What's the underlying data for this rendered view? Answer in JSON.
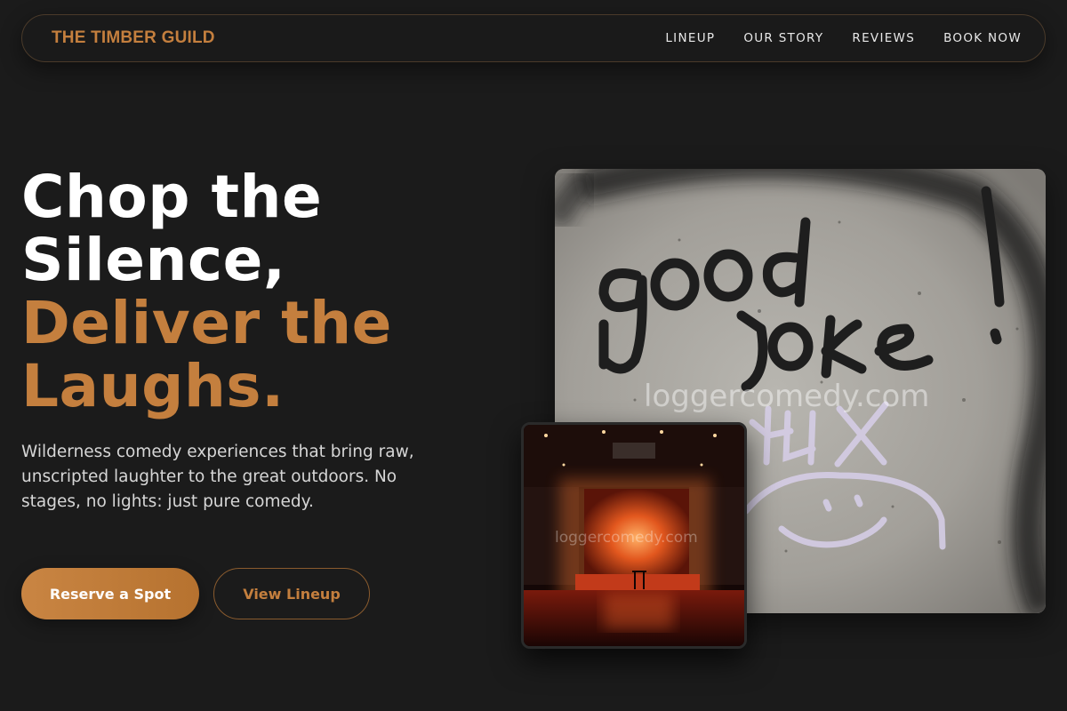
{
  "nav": {
    "brand": "THE TIMBER GUILD",
    "links": [
      "LINEUP",
      "OUR STORY",
      "REVIEWS",
      "BOOK NOW"
    ]
  },
  "hero": {
    "title_white": [
      "Chop the",
      "Silence,"
    ],
    "title_accent": [
      "Deliver the",
      "Laughs."
    ],
    "subtitle": "Wilderness comedy experiences that bring raw, unscripted laughter to the great outdoors. No stages, no lights: just pure comedy.",
    "primary_button": "Reserve a Spot",
    "secondary_button": "View Lineup"
  },
  "images": {
    "main_watermark": "loggercomedy.com",
    "inset_watermark": "loggercomedy.com"
  },
  "colors": {
    "accent": "#c47f3e",
    "background": "#1b1b1b",
    "text": "#ffffff",
    "subtext": "#d6d6d6"
  }
}
